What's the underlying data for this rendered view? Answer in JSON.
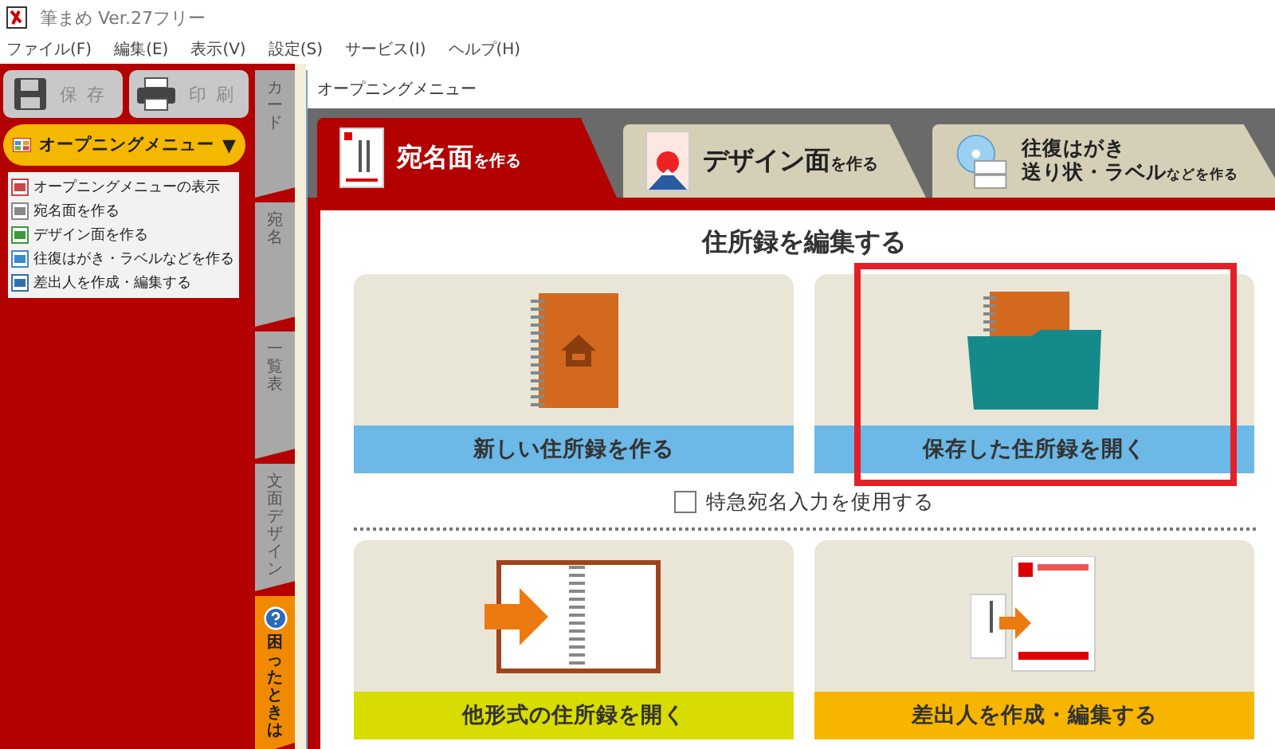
{
  "app": {
    "title": "筆まめ Ver.27フリー"
  },
  "menu": [
    "ファイル(F)",
    "編集(E)",
    "表示(V)",
    "設定(S)",
    "サービス(I)",
    "ヘルプ(H)"
  ],
  "toolbar": [
    {
      "label": "保存",
      "kind": "save",
      "disabled": true
    },
    {
      "label": "印刷",
      "kind": "print",
      "disabled": true
    }
  ],
  "opening_menu": {
    "label": "オープニングメニュー",
    "caret": "▼",
    "expanded": true,
    "items": [
      {
        "label": "オープニングメニューの表示",
        "kind": "menu"
      },
      {
        "label": "宛名面を作る",
        "kind": "address"
      },
      {
        "label": "デザイン面を作る",
        "kind": "design"
      },
      {
        "label": "往復はがき・ラベルなどを作る",
        "kind": "disc"
      },
      {
        "label": "差出人を作成・編集する",
        "kind": "sender"
      }
    ]
  },
  "side_tabs": [
    {
      "label": "カード",
      "kind": "normal"
    },
    {
      "label": "宛名",
      "kind": "normal"
    },
    {
      "label": "一覧表",
      "kind": "normal"
    },
    {
      "label": "文面デザイン",
      "kind": "normal"
    },
    {
      "label": "困ったときは",
      "kind": "help"
    }
  ],
  "dialog": {
    "title": "オープニングメニュー",
    "tabs": [
      {
        "kind": "address",
        "selected": true,
        "lines": [
          {
            "main": "宛名面",
            "suffix": "を作る"
          }
        ]
      },
      {
        "kind": "design",
        "selected": false,
        "lines": [
          {
            "main": "デザイン面",
            "suffix": "を作る"
          }
        ]
      },
      {
        "kind": "disc",
        "selected": false,
        "lines": [
          {
            "main": "往復はがき"
          },
          {
            "main": "送り状・ラベル",
            "suffix": "などを作る"
          }
        ]
      }
    ],
    "heading": "住所録を編集する",
    "cards": [
      {
        "label": "新しい住所録を作る",
        "kind": "notebook",
        "color": "#6cb8e6",
        "highlighted": false
      },
      {
        "label": "保存した住所録を開く",
        "kind": "folder",
        "color": "#6cb8e6",
        "highlighted": true
      },
      {
        "label": "他形式の住所録を開く",
        "kind": "import",
        "color": "#d9dc00",
        "highlighted": false
      },
      {
        "label": "差出人を作成・編集する",
        "kind": "sender",
        "color": "#f7b500",
        "highlighted": false
      }
    ],
    "checkbox": {
      "label": "特急宛名入力を使用する",
      "checked": false
    }
  }
}
